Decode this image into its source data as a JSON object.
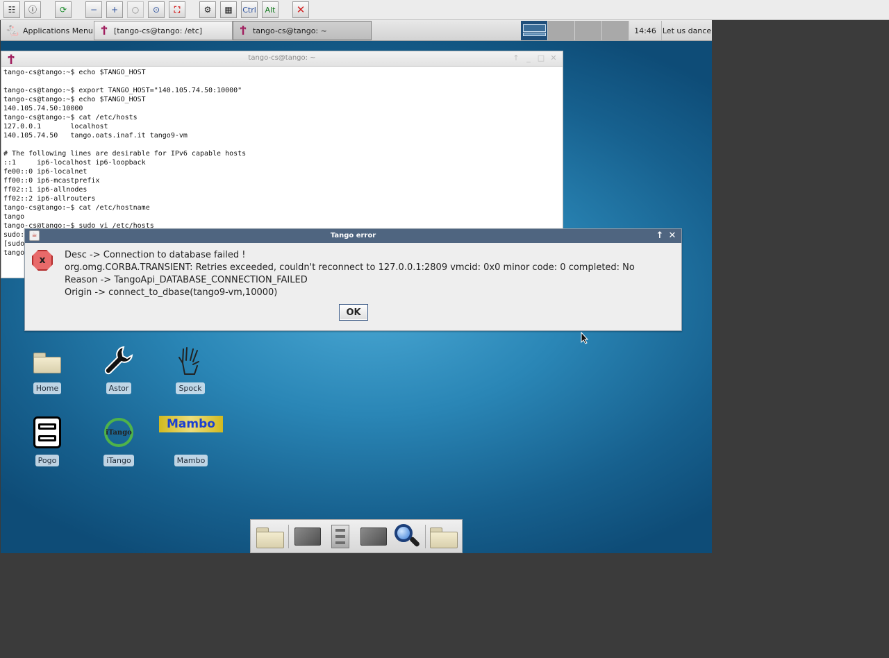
{
  "vnc_toolbar": {
    "buttons": [
      {
        "name": "options",
        "glyph": "☷"
      },
      {
        "name": "connection-info",
        "glyph": "ⓘ"
      },
      {
        "name": "refresh",
        "glyph": "⟳"
      },
      {
        "name": "zoom-out",
        "glyph": "−"
      },
      {
        "name": "zoom-in",
        "glyph": "+"
      },
      {
        "name": "zoom-100",
        "glyph": "○"
      },
      {
        "name": "zoom-fit",
        "glyph": "⊙"
      },
      {
        "name": "fullscreen",
        "glyph": "⛶"
      },
      {
        "name": "ctrl-alt-del",
        "glyph": "⚙"
      },
      {
        "name": "send-keys",
        "glyph": "▦"
      }
    ],
    "ctrl_label": "Ctrl",
    "alt_label": "Alt",
    "disconnect_glyph": "✕"
  },
  "panel": {
    "apps_menu_label": "Applications Menu",
    "tasks": [
      {
        "label": "[tango-cs@tango: /etc]"
      },
      {
        "label": "tango-cs@tango: ~"
      }
    ],
    "clock": "14:46",
    "user": "Let us dance"
  },
  "terminal": {
    "title": "tango-cs@tango: ~",
    "lines": [
      "tango-cs@tango:~$ echo $TANGO_HOST",
      "",
      "tango-cs@tango:~$ export TANGO_HOST=\"140.105.74.50:10000\"",
      "tango-cs@tango:~$ echo $TANGO_HOST",
      "140.105.74.50:10000",
      "tango-cs@tango:~$ cat /etc/hosts",
      "127.0.0.1       localhost",
      "140.105.74.50   tango.oats.inaf.it tango9-vm",
      "",
      "# The following lines are desirable for IPv6 capable hosts",
      "::1     ip6-localhost ip6-loopback",
      "fe00::0 ip6-localnet",
      "ff00::0 ip6-mcastprefix",
      "ff02::1 ip6-allnodes",
      "ff02::2 ip6-allrouters",
      "tango-cs@tango:~$ cat /etc/hostname",
      "tango",
      "tango-cs@tango:~$ sudo vi /etc/hosts",
      "sudo:",
      "[sudo",
      "tango"
    ]
  },
  "desktop_icons": [
    {
      "label": "Home"
    },
    {
      "label": "Astor"
    },
    {
      "label": "Spock"
    },
    {
      "label": "Pogo"
    },
    {
      "label": "iTango",
      "logo_text": "iTango"
    },
    {
      "label": "Mambo",
      "logo_text": "Mambo"
    }
  ],
  "dialog": {
    "title": "Tango error",
    "lines": [
      "Desc -> Connection to database failed  !",
      "org.omg.CORBA.TRANSIENT: Retries exceeded, couldn't reconnect to 127.0.0.1:2809  vmcid: 0x0  minor code: 0  completed: No",
      "Reason -> TangoApi_DATABASE_CONNECTION_FAILED",
      "Origin -> connect_to_dbase(tango9-vm,10000)"
    ],
    "ok_label": "OK",
    "error_glyph": "x"
  },
  "colors": {
    "dialog_title_bg": "#4f6580",
    "error_icon": "#e86a6a",
    "active_workspace": "#1f4f7b"
  }
}
